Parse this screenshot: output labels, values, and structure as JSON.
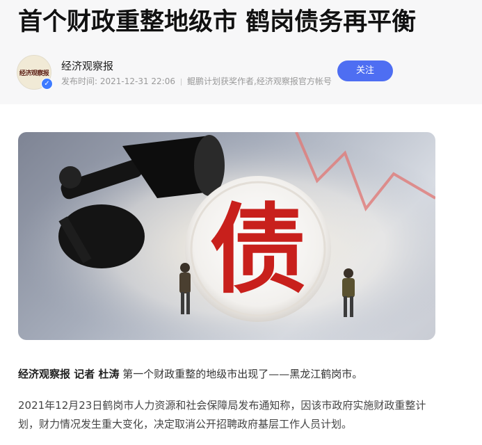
{
  "article": {
    "title": "首个财政重整地级市 鹤岗债务再平衡",
    "author_name": "经济观察报",
    "avatar_text": "经济观察报",
    "publish_label": "发布时间: 2021-12-31 22:06",
    "author_desc": "鲲鹏计划获奖作者,经济观察报官方帐号",
    "follow_label": "关注",
    "image_char": "债",
    "para1_lead": "经济观察报 记者 杜涛",
    "para1_text": " 第一个财政重整的地级市出现了——黑龙江鹤岗市。",
    "para2_text": "2021年12月23日鹤岗市人力资源和社会保障局发布通知称，因该市政府实施财政重整计划，财力情况发生重大变化，决定取消公开招聘政府基层工作人员计划。"
  },
  "colors": {
    "follow_button": "#4e6ef2",
    "verified_badge": "#3e7bff",
    "stamp_red": "#c8201c"
  }
}
